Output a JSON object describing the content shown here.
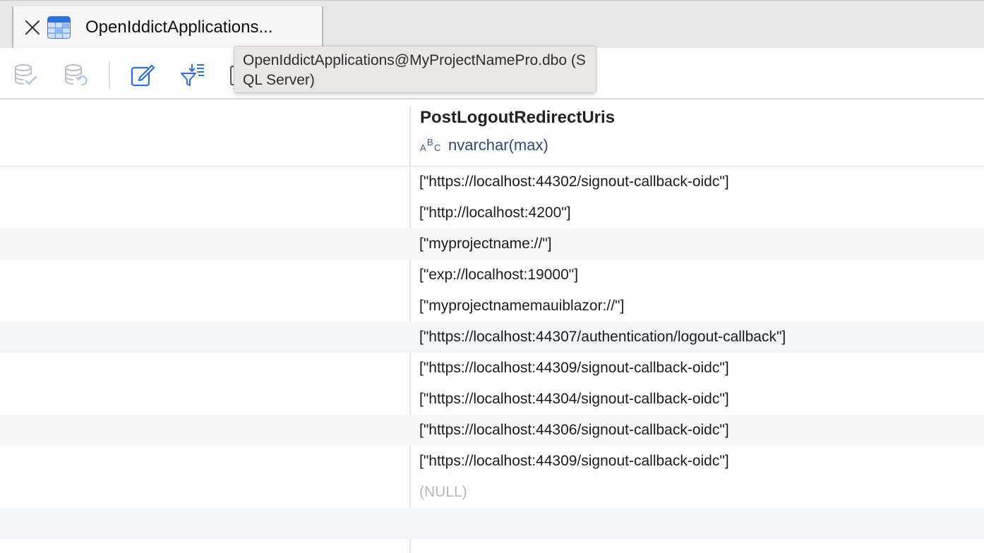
{
  "tab": {
    "title": "OpenIddictApplications..."
  },
  "tooltip": {
    "text": "OpenIddictApplications@MyProjectNamePro.dbo (SQL Server)"
  },
  "toolbar": {
    "icons": [
      "database-check-icon",
      "database-revert-icon",
      "edit-icon",
      "filter-sort-icon"
    ]
  },
  "column": {
    "name": "PostLogoutRedirectUris",
    "type_icon": "ABC",
    "type": "nvarchar(max)"
  },
  "rows": [
    "[\"https://localhost:44302/signout-callback-oidc\"]",
    "[\"http://localhost:4200\"]",
    "[\"myprojectname://\"]",
    "[\"exp://localhost:19000\"]",
    "[\"myprojectnamemauiblazor://\"]",
    "[\"https://localhost:44307/authentication/logout-callback\"]",
    "[\"https://localhost:44309/signout-callback-oidc\"]",
    "[\"https://localhost:44304/signout-callback-oidc\"]",
    "[\"https://localhost:44306/signout-callback-oidc\"]",
    "[\"https://localhost:44309/signout-callback-oidc\"]",
    "(NULL)"
  ],
  "colors": {
    "accent": "#2f7de1",
    "type_text": "#2b4a76",
    "null_text": "#b8b8b8"
  }
}
